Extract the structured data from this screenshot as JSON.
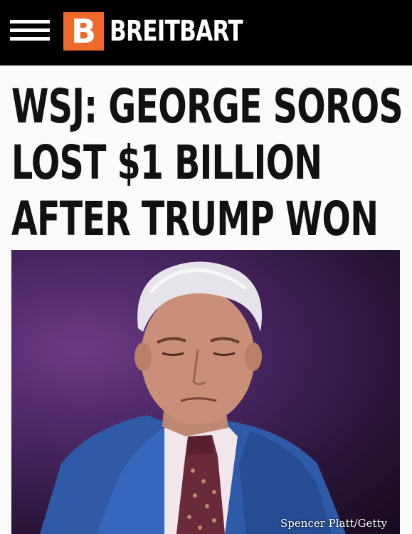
{
  "header": {
    "menu_icon": "hamburger-menu-icon",
    "logo_letter": "B",
    "brand_name": "BREITBART",
    "colors": {
      "bar": "#000000",
      "logo_accent": "#ee6a2c"
    }
  },
  "article": {
    "headline_lines": [
      "WSJ: GEORGE SOROS",
      "LOST $1 BILLION",
      "AFTER TRUMP WON"
    ],
    "photo_credit": "Spencer Platt/Getty"
  }
}
